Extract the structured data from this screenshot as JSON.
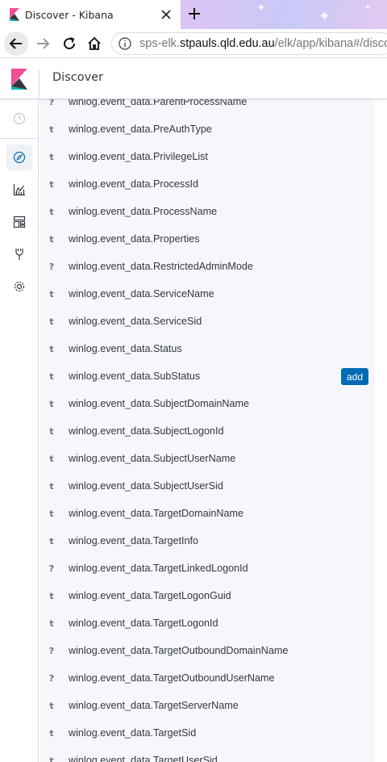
{
  "browser": {
    "tab_title": "Discover - Kibana",
    "url_prefix": "sps-elk.",
    "url_domain": "stpauls.qld.edu.au",
    "url_path": "/elk/app/kibana#/discover"
  },
  "app": {
    "page_title": "Discover",
    "accent_color": "#006bb4",
    "nav_items": [
      "clock-icon",
      "compass-icon",
      "visualize-icon",
      "dashboard-icon",
      "dev-tools-icon",
      "gear-icon"
    ]
  },
  "fields": [
    {
      "type": "?",
      "name": "winlog.event_data.ParentProcessName"
    },
    {
      "type": "t",
      "name": "winlog.event_data.PreAuthType"
    },
    {
      "type": "t",
      "name": "winlog.event_data.PrivilegeList"
    },
    {
      "type": "t",
      "name": "winlog.event_data.ProcessId"
    },
    {
      "type": "t",
      "name": "winlog.event_data.ProcessName"
    },
    {
      "type": "t",
      "name": "winlog.event_data.Properties"
    },
    {
      "type": "?",
      "name": "winlog.event_data.RestrictedAdminMode"
    },
    {
      "type": "t",
      "name": "winlog.event_data.ServiceName"
    },
    {
      "type": "t",
      "name": "winlog.event_data.ServiceSid"
    },
    {
      "type": "t",
      "name": "winlog.event_data.Status"
    },
    {
      "type": "t",
      "name": "winlog.event_data.SubStatus",
      "add_label": "add"
    },
    {
      "type": "t",
      "name": "winlog.event_data.SubjectDomainName"
    },
    {
      "type": "t",
      "name": "winlog.event_data.SubjectLogonId"
    },
    {
      "type": "t",
      "name": "winlog.event_data.SubjectUserName"
    },
    {
      "type": "t",
      "name": "winlog.event_data.SubjectUserSid"
    },
    {
      "type": "t",
      "name": "winlog.event_data.TargetDomainName"
    },
    {
      "type": "t",
      "name": "winlog.event_data.TargetInfo"
    },
    {
      "type": "?",
      "name": "winlog.event_data.TargetLinkedLogonId"
    },
    {
      "type": "t",
      "name": "winlog.event_data.TargetLogonGuid"
    },
    {
      "type": "t",
      "name": "winlog.event_data.TargetLogonId"
    },
    {
      "type": "?",
      "name": "winlog.event_data.TargetOutboundDomainName"
    },
    {
      "type": "?",
      "name": "winlog.event_data.TargetOutboundUserName"
    },
    {
      "type": "t",
      "name": "winlog.event_data.TargetServerName"
    },
    {
      "type": "t",
      "name": "winlog.event_data.TargetSid"
    },
    {
      "type": "t",
      "name": "winlog.event_data.TargetUserSid"
    }
  ]
}
